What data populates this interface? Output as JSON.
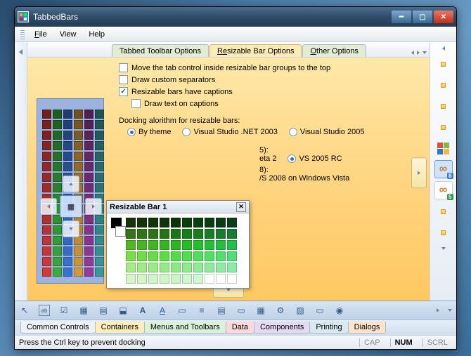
{
  "title": "TabbedBars",
  "menus": {
    "file": "File",
    "view": "View",
    "help": "Help"
  },
  "tabs": {
    "toolbar": "Tabbed Toolbar Options",
    "resizable": "Resizable Bar Options",
    "other": "Other Options"
  },
  "options": {
    "move_top": "Move the tab control inside resizable bar groups to the top",
    "draw_sep": "Draw custom separators",
    "captions": "Resizable bars have captions",
    "draw_text": "Draw text on captions",
    "dock_label": "Docking alorithm for resizable bars:",
    "r_theme": "By theme",
    "r_vs2003": "Visual Studio .NET 2003",
    "r_vs2005": "Visual Studio 2005",
    "row2_suffix": "5):",
    "r_beta2": "eta 2",
    "r_vs2005rc": "VS 2005 RC",
    "row3_suffix": "8):",
    "row3_tail": "/S 2008 on Windows Vista"
  },
  "float": {
    "title": "Resizable Bar 1"
  },
  "rail_icons": [
    "of",
    "of",
    "of",
    "of",
    "win",
    "vs-8",
    "vs-5",
    "of",
    "of"
  ],
  "bottom_tabs": {
    "cc": "Common Controls",
    "co": "Containers",
    "mt": "Menus and Toolbars",
    "da": "Data",
    "cp": "Components",
    "pr": "Printing",
    "di": "Dialogs"
  },
  "status": {
    "text": "Press the Ctrl key to prevent docking",
    "cap": "CAP",
    "num": "NUM",
    "scrl": "SCRL"
  }
}
